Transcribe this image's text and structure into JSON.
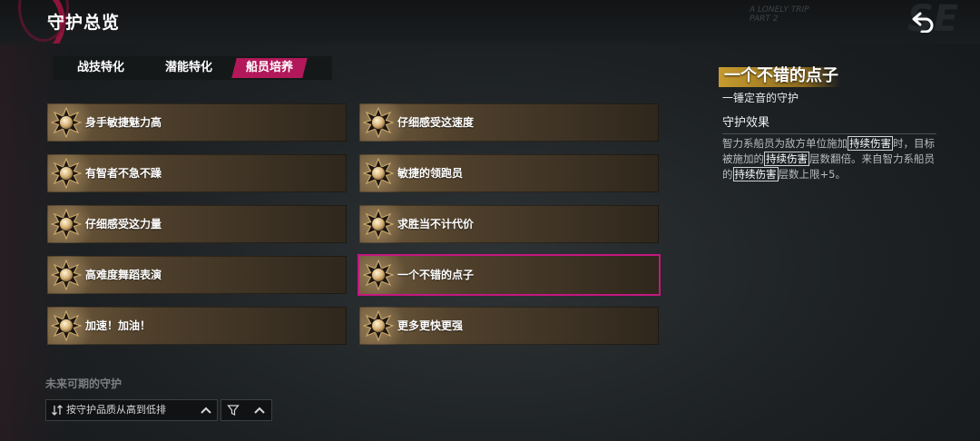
{
  "header": {
    "title": "守护总览",
    "deco_line1": "A LONELY TRIP",
    "deco_line2": "PART 2",
    "deco_big": "SE"
  },
  "tabs": [
    {
      "label": "战技特化",
      "active": false
    },
    {
      "label": "潜能特化",
      "active": false
    },
    {
      "label": "船员培养",
      "active": true
    }
  ],
  "cards_left": [
    {
      "label": "身手敏捷魅力高"
    },
    {
      "label": "有智者不急不躁"
    },
    {
      "label": "仔细感受这力量"
    },
    {
      "label": "高难度舞蹈表演"
    },
    {
      "label": "加速！加油！"
    }
  ],
  "cards_right": [
    {
      "label": "仔细感受这速度"
    },
    {
      "label": "敏捷的领跑员"
    },
    {
      "label": "求胜当不计代价"
    },
    {
      "label": "一个不错的点子",
      "selected": true
    },
    {
      "label": "更多更快更强"
    }
  ],
  "coming_soon": "未来可期的守护",
  "sort": {
    "label": "按守护品质从高到低排"
  },
  "detail": {
    "title": "一个不错的点子",
    "subtitle": "一锤定音的守护",
    "effect_heading": "守护效果",
    "effect": {
      "p1": "智力系船员为敌方单位施加",
      "kw1": "持续伤害",
      "p2": "时，目标被施加的",
      "kw2": "持续伤害",
      "p3": "层数翻倍。来自智力系船员的",
      "kw3": "持续伤害",
      "p4": "层数上限+5。"
    }
  },
  "colors": {
    "accent": "#b2185a",
    "selected_border": "#c4177f",
    "title_highlight": "#c79b2e"
  }
}
